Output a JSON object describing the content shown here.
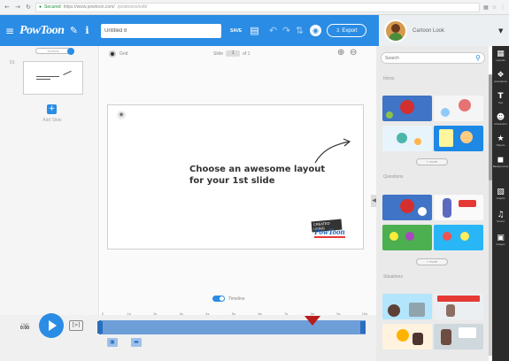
{
  "browser": {
    "security_label": "Secured",
    "url": "https://www.powtoon.com/",
    "url_tail": "/powtoons/edit/"
  },
  "toolbar": {
    "logo": "PowToon",
    "title_value": "Untitled 8",
    "save_label": "SAVE",
    "export_label": "Export",
    "user_name": "Cartoon Look"
  },
  "left_panel": {
    "pill_label": "Normal",
    "slide_number": "01",
    "add_slide_label": "Add Slide"
  },
  "canvas": {
    "grid_label": "Grid",
    "slide_label": "Slide",
    "slide_current": "1",
    "slide_total_label": "of 1",
    "hint_line1": "Choose an awesome layout",
    "hint_line2": "for your 1st slide",
    "brand_top": "CREATED USING",
    "brand_bottom": "PowToon"
  },
  "right_panel": {
    "search_placeholder": "Search",
    "sections": [
      "Intros",
      "Questions",
      "Situations"
    ],
    "more_label": "+ more"
  },
  "strip": [
    {
      "icon": "layouts-icon",
      "label": "Layouts"
    },
    {
      "icon": "animations-icon",
      "label": "Animations"
    },
    {
      "icon": "text-icon",
      "label": "Text"
    },
    {
      "icon": "characters-icon",
      "label": "Characters"
    },
    {
      "icon": "objects-icon",
      "label": "Objects"
    },
    {
      "icon": "backgrounds-icon",
      "label": "Backgrounds"
    },
    {
      "icon": "graphs-icon",
      "label": "Graphs"
    },
    {
      "icon": "sound-icon",
      "label": "Sound"
    },
    {
      "icon": "images-icon",
      "label": "Images"
    }
  ],
  "timeline": {
    "toggle_label": "Timeline",
    "time_caption": "TIME",
    "time_value": "0:00",
    "step_label": "[>]",
    "ticks": [
      "0",
      "1s",
      "2s",
      "3s",
      "4s",
      "5s",
      "6s",
      "7s",
      "8s",
      "9s",
      "10s"
    ],
    "playhead_fraction": 0.8
  },
  "colors": {
    "brand_blue": "#2a8ce4",
    "playhead_red": "#b71c1c"
  }
}
